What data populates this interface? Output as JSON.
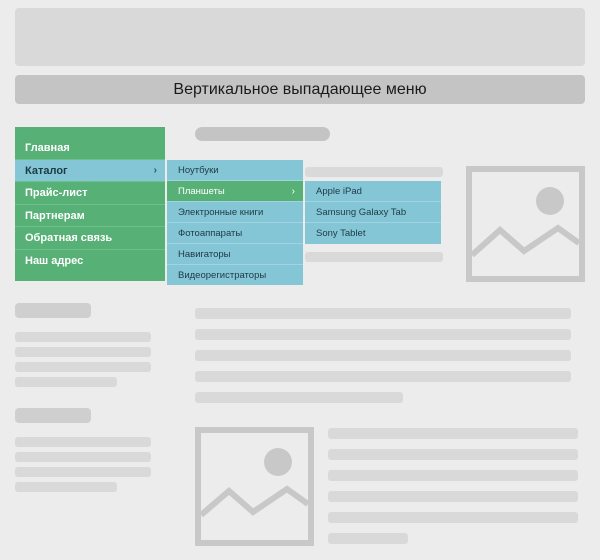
{
  "page_title": "Вертикальное выпадающее меню",
  "main_menu": [
    {
      "label": "Главная"
    },
    {
      "label": "Каталог",
      "arrow": "›"
    },
    {
      "label": "Прайс-лист"
    },
    {
      "label": "Партнерам"
    },
    {
      "label": "Обратная связь"
    },
    {
      "label": "Наш адрес"
    }
  ],
  "catalog_submenu": [
    {
      "label": "Ноутбуки"
    },
    {
      "label": "Планшеты",
      "arrow": "›"
    },
    {
      "label": "Электронные книги"
    },
    {
      "label": "Фотоаппараты"
    },
    {
      "label": "Навигаторы"
    },
    {
      "label": "Видеорегистраторы"
    }
  ],
  "tablets_submenu": [
    {
      "label": "Apple iPad"
    },
    {
      "label": "Samsung Galaxy Tab"
    },
    {
      "label": "Sony Tablet"
    }
  ],
  "colors": {
    "menu_green": "#57b075",
    "menu_blue": "#84c6d6",
    "placeholder": "#d9d9d9",
    "background": "#ececec"
  }
}
